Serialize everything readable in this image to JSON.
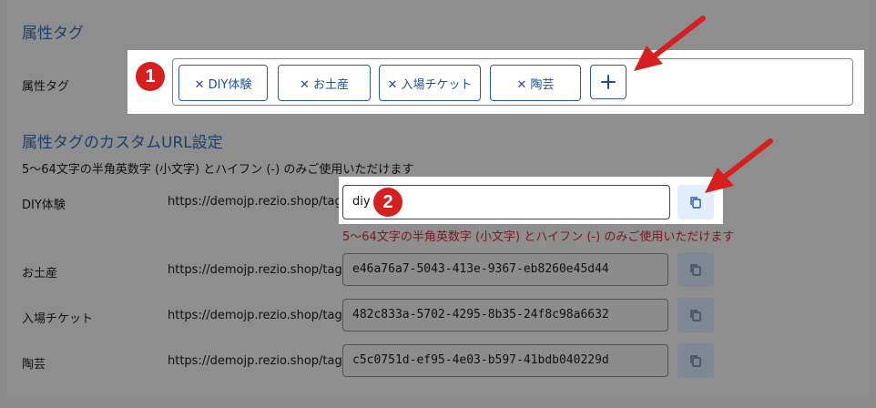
{
  "section1": {
    "title": "属性タグ",
    "row_label": "属性タグ"
  },
  "tags": [
    {
      "label": "✕ DIY体験"
    },
    {
      "label": "✕ お土産"
    },
    {
      "label": "✕ 入場チケット"
    },
    {
      "label": "✕ 陶芸"
    }
  ],
  "add_tag_symbol": "+",
  "section2": {
    "title": "属性タグのカスタムURL設定",
    "hint": "5〜64文字の半角英数字 (小文字) とハイフン (-) のみご使用いただけます"
  },
  "url_prefix": "https://demojp.rezio.shop/tag/",
  "rows": [
    {
      "label": "DIY体験",
      "value": "diy",
      "error": "5〜64文字の半角英数字 (小文字) とハイフン (-) のみご使用いただけます"
    },
    {
      "label": "お土産",
      "value": "e46a76a7-5043-413e-9367-eb8260e45d44"
    },
    {
      "label": "入場チケット",
      "value": "482c833a-5702-4295-8b35-24f8c98a6632"
    },
    {
      "label": "陶芸",
      "value": "c5c0751d-ef95-4e03-b597-41bdb040229d"
    }
  ],
  "badges": [
    "1",
    "2"
  ],
  "colors": {
    "accent": "#2a5a9c",
    "badge": "#d61f1f",
    "error": "#7a1a22",
    "overlay": "#8e8e8e"
  },
  "icons": {
    "copy": "copy-icon",
    "arrow": "red-arrow-icon",
    "plus": "plus-icon"
  }
}
